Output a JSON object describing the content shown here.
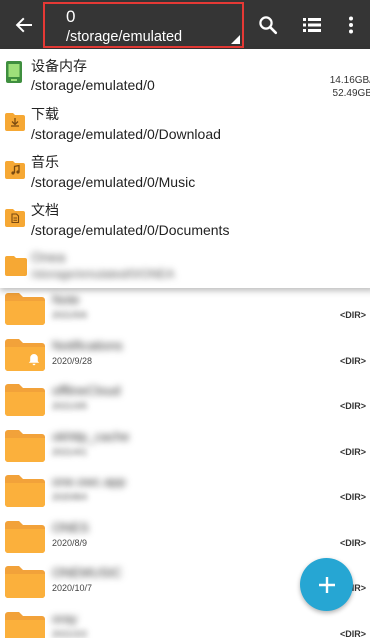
{
  "toolbar": {
    "back_icon": "arrow-left-icon",
    "path_number": "0",
    "path": "/storage/emulated",
    "search_icon": "search-icon",
    "view_icon": "list-view-icon",
    "more_icon": "more-vert-icon"
  },
  "dropdown": {
    "items": [
      {
        "title": "设备内存",
        "path": "/storage/emulated/0",
        "size_free": "14.16GB/",
        "size_total": "52.49GB",
        "icon": "device-storage-icon"
      },
      {
        "title": "下载",
        "path": "/storage/emulated/0/Download",
        "icon": "download-folder-icon"
      },
      {
        "title": "音乐",
        "path": "/storage/emulated/0/Music",
        "icon": "music-folder-icon"
      },
      {
        "title": "文档",
        "path": "/storage/emulated/0/Documents",
        "icon": "documents-folder-icon"
      },
      {
        "title": "Onea",
        "path": "/storage/emulated/0/ONEA",
        "icon": "folder-icon"
      }
    ]
  },
  "list": {
    "rows": [
      {
        "name": "Note",
        "date": "2021/5/6",
        "date_blurred": true,
        "tag": "<DIR>"
      },
      {
        "name": "Notifications",
        "date": "2020/9/28",
        "date_blurred": false,
        "tag": "<DIR>"
      },
      {
        "name": "offlineCloud",
        "date": "2021/3/5",
        "date_blurred": true,
        "tag": "<DIR>"
      },
      {
        "name": "okhttp_cache",
        "date": "2021/4/1",
        "date_blurred": true,
        "tag": "<DIR>"
      },
      {
        "name": "one.owc.app",
        "date": "2020/8/4",
        "date_blurred": true,
        "tag": "<DIR>"
      },
      {
        "name": "ONES",
        "date": "2020/8/9",
        "date_blurred": false,
        "tag": "<DIR>"
      },
      {
        "name": "ONEMUSIC",
        "date": "2020/10/7",
        "date_blurred": false,
        "tag": "<DIR>"
      },
      {
        "name": "oray",
        "date": "2021/2/2",
        "date_blurred": true,
        "tag": "<DIR>"
      }
    ]
  },
  "fab": {
    "icon": "plus-icon"
  }
}
